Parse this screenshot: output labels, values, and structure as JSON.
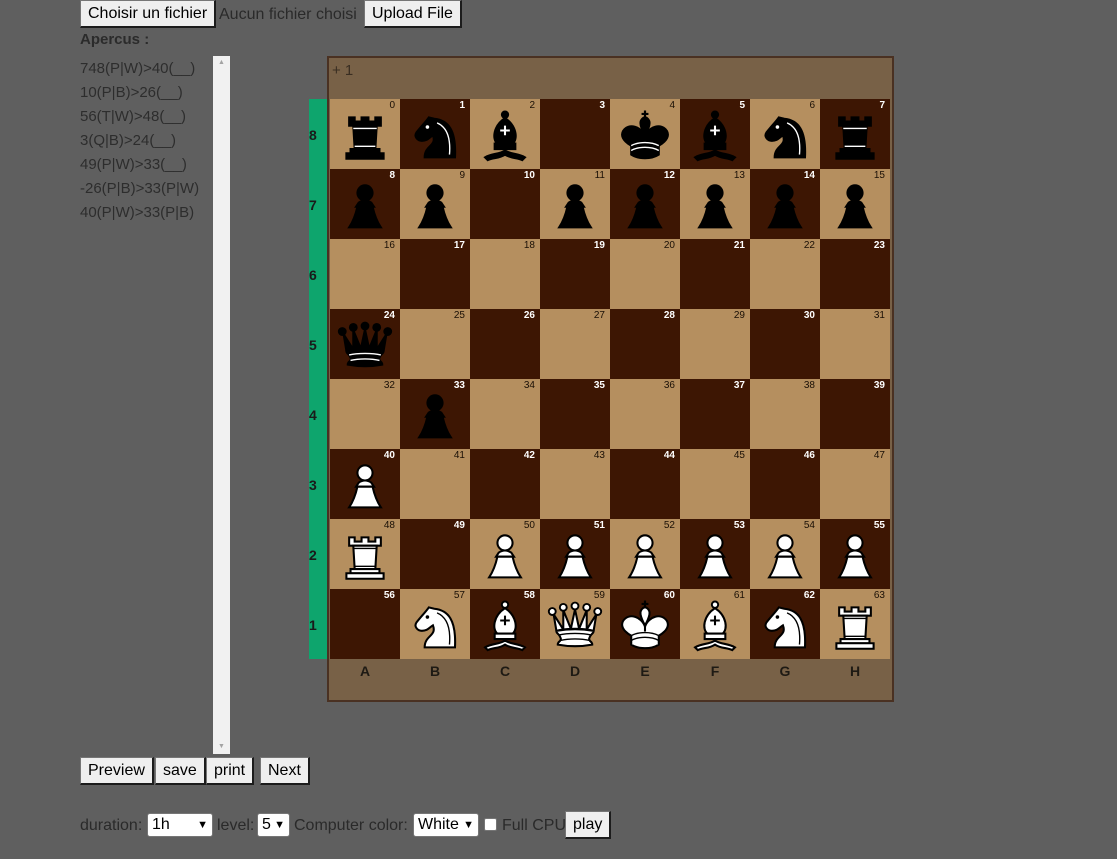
{
  "file_input": {
    "choose_label": "Choisir un fichier",
    "status": "Aucun fichier choisi",
    "upload_label": "Upload File"
  },
  "apercus": {
    "title": "Apercus :",
    "moves": [
      "748(P|W)>40(__)",
      "10(P|B)>26(__)",
      "56(T|W)>48(__)",
      "3(Q|B)>24(__)",
      "49(P|W)>33(__)",
      "-26(P|B)>33(P|W)",
      "40(P|W)>33(P|B)"
    ]
  },
  "board": {
    "turn_indicator": "+ 1",
    "ranks": [
      "8",
      "7",
      "6",
      "5",
      "4",
      "3",
      "2",
      "1"
    ],
    "files": [
      "A",
      "B",
      "C",
      "D",
      "E",
      "F",
      "G",
      "H"
    ],
    "light_color": "#b58f5f",
    "dark_color": "#3d1603",
    "rank_strip_color": "#0ea56d",
    "pieces": [
      "bR",
      "bN",
      "bB",
      "",
      "bK",
      "bB",
      "bN",
      "bR",
      "bP",
      "bP",
      "",
      "bP",
      "bP",
      "bP",
      "bP",
      "bP",
      "",
      "",
      "",
      "",
      "",
      "",
      "",
      "",
      "bQ",
      "",
      "",
      "",
      "",
      "",
      "",
      "",
      "",
      "bP",
      "",
      "",
      "",
      "",
      "",
      "",
      "wP",
      "",
      "",
      "",
      "",
      "",
      "",
      "",
      "wR",
      "",
      "wP",
      "wP",
      "wP",
      "wP",
      "wP",
      "wP",
      "",
      "wN",
      "wB",
      "wQ",
      "wK",
      "wB",
      "wN",
      "wR"
    ]
  },
  "actions": {
    "preview": "Preview",
    "save": "save",
    "print": "print",
    "next": "Next"
  },
  "settings": {
    "duration_label": "duration:",
    "duration_value": "1h",
    "level_label": "level:",
    "level_value": "5",
    "color_label": "Computer color:",
    "color_value": "White",
    "full_cpu_label": "Full CPU",
    "full_cpu_checked": false,
    "play_label": "play"
  }
}
